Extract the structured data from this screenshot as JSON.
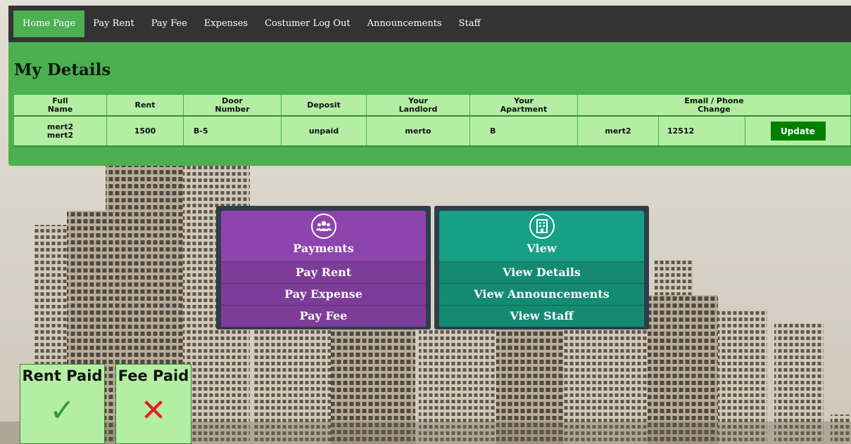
{
  "nav": {
    "items": [
      "Home Page",
      "Pay Rent",
      "Pay Fee",
      "Expenses",
      "Costumer Log Out",
      "Announcements",
      "Staff"
    ]
  },
  "details": {
    "title": "My Details",
    "headers": {
      "full_name_1": "Full",
      "full_name_2": "Name",
      "rent": "Rent",
      "door_1": "Door",
      "door_2": "Number",
      "deposit": "Deposit",
      "landlord_1": "Your",
      "landlord_2": "Landlord",
      "apartment_1": "Your",
      "apartment_2": "Apartment",
      "change_1": "Email / Phone",
      "change_2": "Change"
    },
    "row": {
      "first_name": "mert2",
      "last_name": "mert2",
      "rent": "1500",
      "door": "B-5",
      "deposit": "unpaid",
      "landlord": "merto",
      "apartment": "B",
      "email": "mert2",
      "phone": "12512",
      "update_label": "Update"
    }
  },
  "payments": {
    "title": "Payments",
    "icon": "users-icon",
    "items": [
      "Pay Rent",
      "Pay Expense",
      "Pay Fee"
    ]
  },
  "view": {
    "title": "View",
    "icon": "building-icon",
    "items": [
      "View Details",
      "View Announcements",
      "View Staff"
    ]
  },
  "status": {
    "rent_label": "Rent Paid",
    "rent_mark": "✓",
    "fee_label": "Fee Paid",
    "fee_mark": "✕"
  },
  "colors": {
    "nav_bg": "#333333",
    "accent_green": "#4caf50",
    "table_row": "#b4eea4",
    "button_green": "#008000",
    "payments_purple": "#8e44ad",
    "view_teal": "#16a085"
  }
}
